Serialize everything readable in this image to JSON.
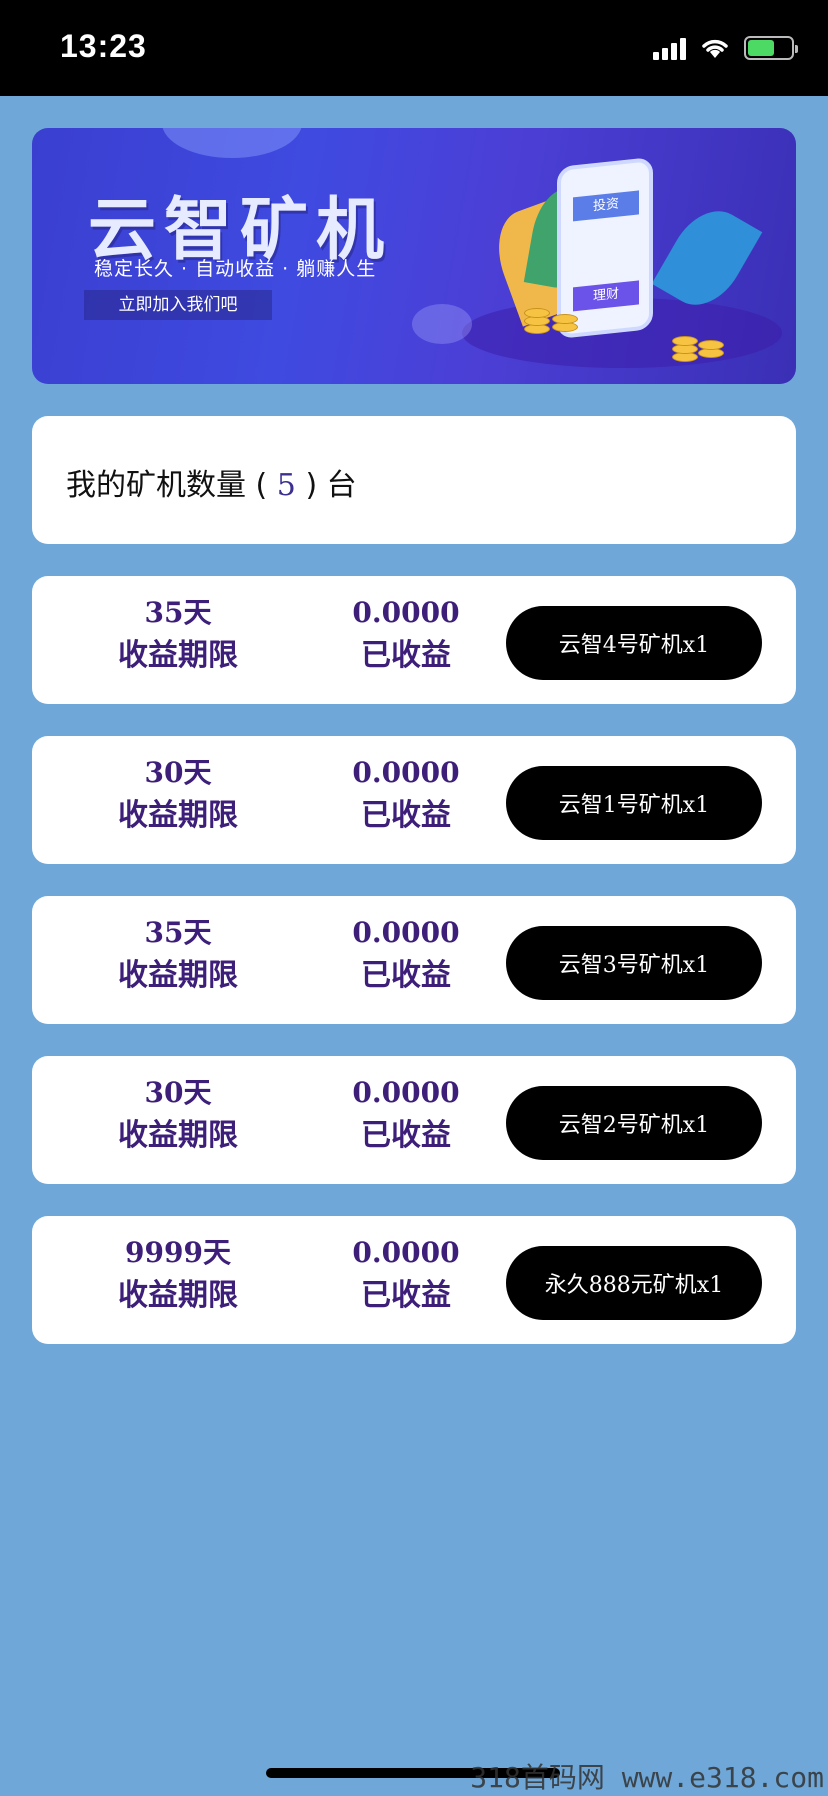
{
  "status_bar": {
    "time": "13:23"
  },
  "banner": {
    "title": "云智矿机",
    "subtitle": "稳定长久 · 自动收益 · 躺赚人生",
    "button": "立即加入我们吧",
    "phone_top": "投资",
    "phone_bottom": "理财"
  },
  "summary": {
    "prefix": "我的矿机数量 (",
    "count": "5",
    "suffix": ") 台"
  },
  "machines": [
    {
      "days": "35天",
      "days_label": "收益期限",
      "earned": "0.0000",
      "earned_label": "已收益",
      "name": "云智4号矿机x1"
    },
    {
      "days": "30天",
      "days_label": "收益期限",
      "earned": "0.0000",
      "earned_label": "已收益",
      "name": "云智1号矿机x1"
    },
    {
      "days": "35天",
      "days_label": "收益期限",
      "earned": "0.0000",
      "earned_label": "已收益",
      "name": "云智3号矿机x1"
    },
    {
      "days": "30天",
      "days_label": "收益期限",
      "earned": "0.0000",
      "earned_label": "已收益",
      "name": "云智2号矿机x1"
    },
    {
      "days": "9999天",
      "days_label": "收益期限",
      "earned": "0.0000",
      "earned_label": "已收益",
      "name": "永久888元矿机x1"
    }
  ],
  "watermark": "318首码网  www.e318.com",
  "colors": {
    "background": "#6fa8d8",
    "accent_text": "#3d1f7a",
    "button": "#000000"
  }
}
